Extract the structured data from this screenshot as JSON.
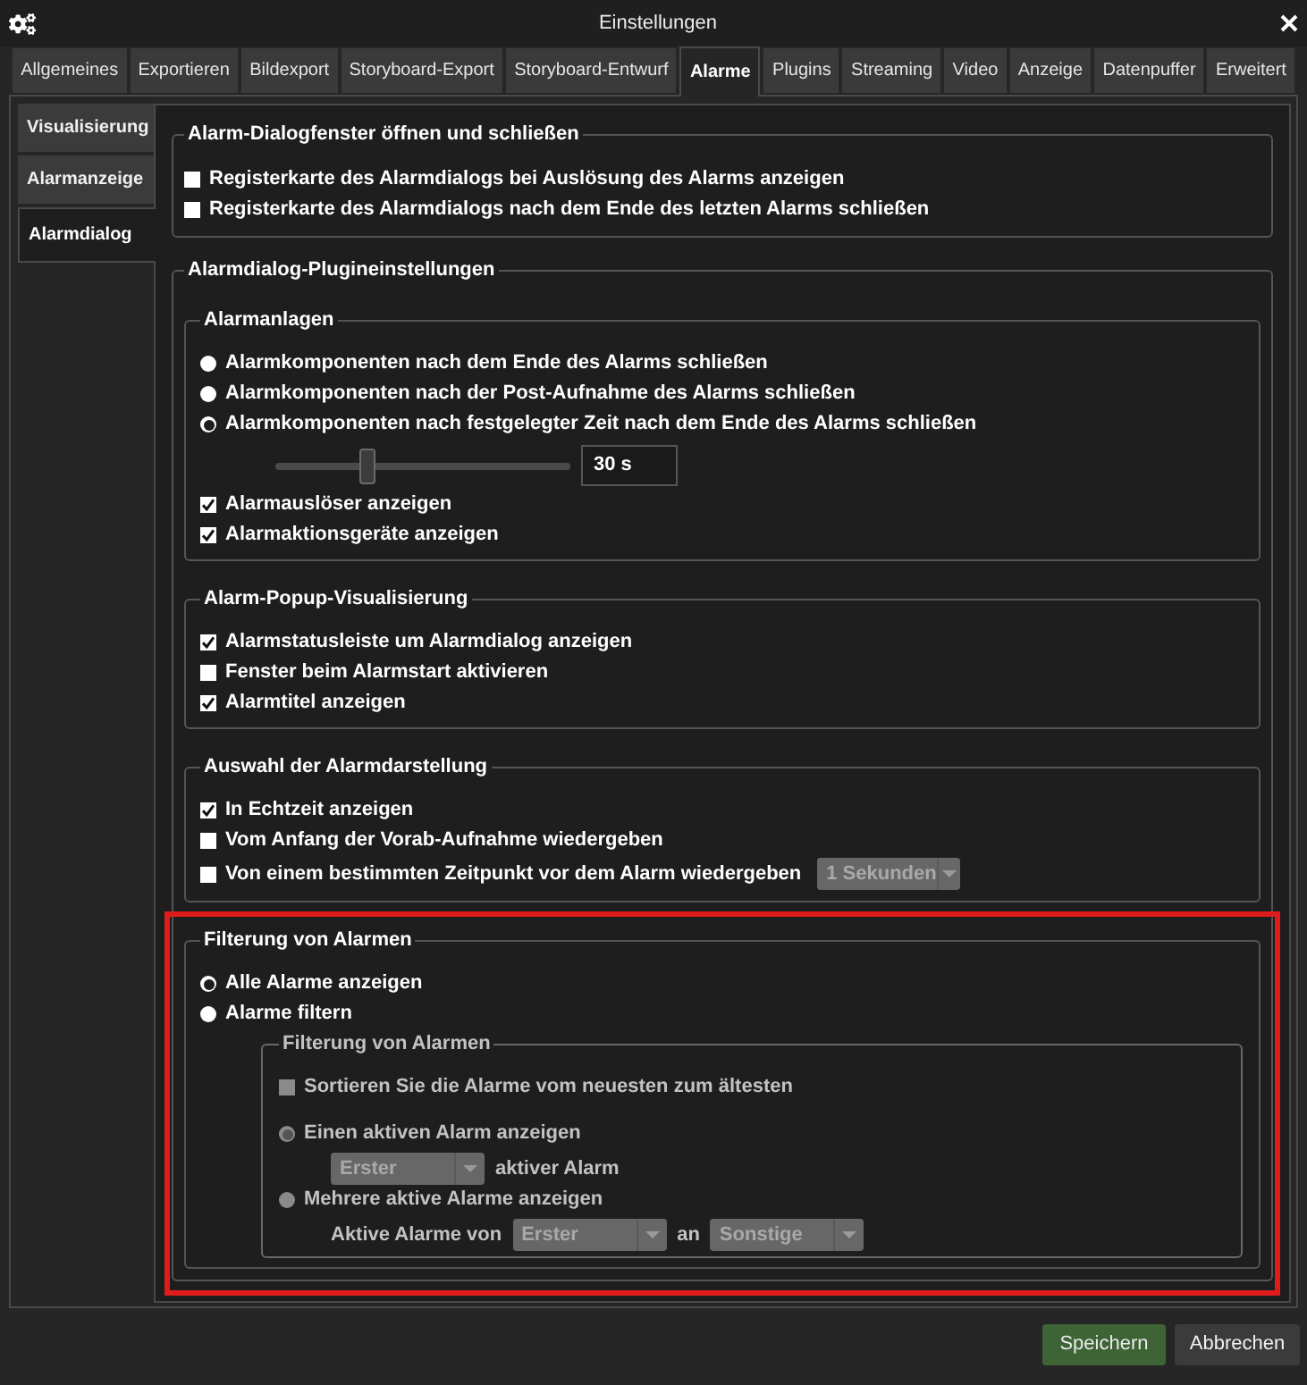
{
  "window": {
    "title": "Einstellungen"
  },
  "tabs": [
    {
      "label": "Allgemeines",
      "selected": false
    },
    {
      "label": "Exportieren",
      "selected": false
    },
    {
      "label": "Bildexport",
      "selected": false
    },
    {
      "label": "Storyboard-Export",
      "selected": false
    },
    {
      "label": "Storyboard-Entwurf",
      "selected": false
    },
    {
      "label": "Alarme",
      "selected": true
    },
    {
      "label": "Plugins",
      "selected": false
    },
    {
      "label": "Streaming",
      "selected": false
    },
    {
      "label": "Video",
      "selected": false
    },
    {
      "label": "Anzeige",
      "selected": false
    },
    {
      "label": "Datenpuffer",
      "selected": false
    },
    {
      "label": "Erweitert",
      "selected": false
    }
  ],
  "side_tabs": [
    {
      "label": "Visualisierung",
      "selected": false
    },
    {
      "label": "Alarmanzeige",
      "selected": false
    },
    {
      "label": "Alarmdialog",
      "selected": true
    }
  ],
  "groups": [
    {
      "title": "Alarm-Dialogfenster öffnen und schließen",
      "items": [
        {
          "kind": "checkbox",
          "label": "Registerkarte des Alarmdialogs bei Auslösung des Alarms anzeigen",
          "checked": false
        },
        {
          "kind": "checkbox",
          "label": "Registerkarte des Alarmdialogs nach dem Ende des letzten Alarms schließen",
          "checked": false
        }
      ]
    },
    {
      "title": "Alarmdialog-Plugineinstellungen",
      "items": [
        {
          "kind": "group",
          "title": "Alarmanlagen",
          "items": [
            {
              "kind": "radio",
              "label": "Alarmkomponenten nach dem Ende des Alarms schließen",
              "selected": false
            },
            {
              "kind": "radio",
              "label": "Alarmkomponenten nach der Post-Aufnahme des Alarms schließen",
              "selected": false
            },
            {
              "kind": "radio",
              "label": "Alarmkomponenten nach festgelegter Zeit nach dem Ende des Alarms schließen",
              "selected": true
            },
            {
              "kind": "slider",
              "level": 0.3,
              "value": "30 s"
            },
            {
              "kind": "checkbox",
              "label": "Alarmauslöser anzeigen",
              "checked": true
            },
            {
              "kind": "checkbox",
              "label": "Alarmaktionsgeräte anzeigen",
              "checked": true
            }
          ]
        },
        {
          "kind": "group",
          "title": "Alarm-Popup-Visualisierung",
          "items": [
            {
              "kind": "checkbox",
              "label": "Alarmstatusleiste um Alarmdialog anzeigen",
              "checked": true
            },
            {
              "kind": "checkbox",
              "label": "Fenster beim Alarmstart aktivieren",
              "checked": false
            },
            {
              "kind": "checkbox",
              "label": "Alarmtitel anzeigen",
              "checked": true
            }
          ]
        },
        {
          "kind": "group",
          "title": "Auswahl der Alarmdarstellung",
          "items": [
            {
              "kind": "checkbox",
              "label": "In Echtzeit anzeigen",
              "checked": true
            },
            {
              "kind": "checkbox",
              "label": "Vom Anfang der Vorab-Aufnahme wiedergeben",
              "checked": false
            },
            {
              "kind": "checkbox",
              "label": "Von einem bestimmten Zeitpunkt vor dem Alarm wiedergeben",
              "checked": false,
              "dropdown": {
                "value": "1 Sekunden",
                "disabled": true
              }
            }
          ]
        },
        {
          "kind": "group",
          "title": "Filterung von Alarmen",
          "highlighted": true,
          "items": [
            {
              "kind": "radio",
              "label": "Alle Alarme anzeigen",
              "selected": true
            },
            {
              "kind": "radio",
              "label": "Alarme filtern",
              "selected": false
            },
            {
              "kind": "group",
              "title": "Filterung von Alarmen",
              "disabled": true,
              "items": [
                {
                  "kind": "checkbox",
                  "label": "Sortieren Sie die Alarme vom neuesten zum ältesten",
                  "checked": false
                },
                {
                  "kind": "radio",
                  "label": "Einen aktiven Alarm anzeigen",
                  "selected": true
                },
                {
                  "kind": "row",
                  "parts": [
                    {
                      "kind": "dropdown",
                      "value": "Erster"
                    },
                    {
                      "kind": "text",
                      "text": "aktiver Alarm"
                    }
                  ]
                },
                {
                  "kind": "radio",
                  "label": "Mehrere aktive Alarme anzeigen",
                  "selected": false
                },
                {
                  "kind": "row",
                  "parts": [
                    {
                      "kind": "text",
                      "text": "Aktive Alarme von"
                    },
                    {
                      "kind": "dropdown",
                      "value": "Erster"
                    },
                    {
                      "kind": "text",
                      "text": "an"
                    },
                    {
                      "kind": "dropdown",
                      "value": "Sonstige"
                    }
                  ]
                }
              ]
            }
          ]
        }
      ]
    }
  ],
  "buttons": [
    {
      "label": "Speichern",
      "kind": "primary"
    },
    {
      "label": "Abbrechen",
      "kind": "secondary"
    }
  ]
}
